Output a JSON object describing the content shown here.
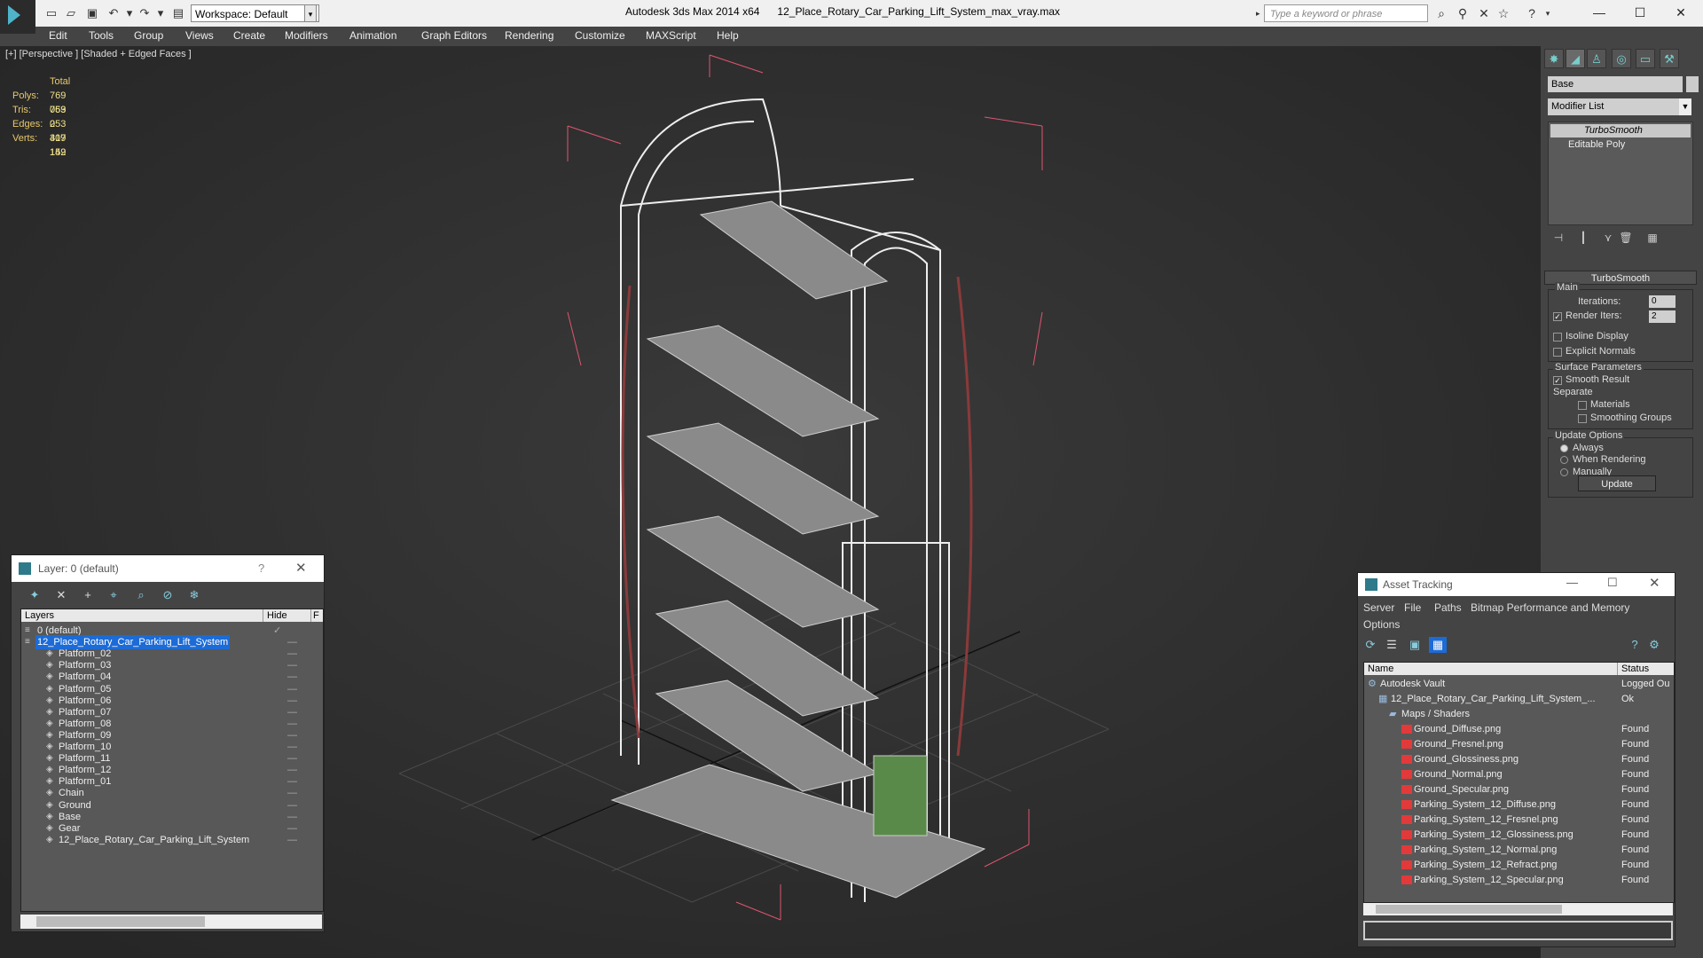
{
  "titlebar": {
    "app_name": "Autodesk 3ds Max  2014 x64",
    "file_name": "12_Place_Rotary_Car_Parking_Lift_System_max_vray.max",
    "workspace": "Workspace: Default",
    "search_placeholder": "Type a keyword or phrase"
  },
  "menubar": {
    "items": [
      "Edit",
      "Tools",
      "Group",
      "Views",
      "Create",
      "Modifiers",
      "Animation",
      "Graph Editors",
      "Rendering",
      "Customize",
      "MAXScript",
      "Help"
    ]
  },
  "viewport": {
    "label": "[+] [Perspective ] [Shaded + Edged Faces ]",
    "stats": {
      "header": "Total",
      "polys_label": "Polys:",
      "polys": "769 053",
      "tris_label": "Tris:",
      "tris": "769 053",
      "edges_label": "Edges:",
      "edges": "2 307 159",
      "verts_label": "Verts:",
      "verts": "419 142"
    }
  },
  "command_panel": {
    "object_name": "Base",
    "modifier_list": "Modifier List",
    "stack": [
      "TurboSmooth",
      "Editable Poly"
    ],
    "rollout_title": "TurboSmooth",
    "main_group": "Main",
    "iterations_label": "Iterations:",
    "iterations": "0",
    "render_iters_label": "Render Iters:",
    "render_iters": "2",
    "isoline_label": "Isoline Display",
    "explicit_normals_label": "Explicit Normals",
    "surface_group": "Surface Parameters",
    "smooth_result_label": "Smooth Result",
    "separate_label": "Separate",
    "materials_label": "Materials",
    "smoothing_groups_label": "Smoothing Groups",
    "update_group": "Update Options",
    "always_label": "Always",
    "when_rendering_label": "When Rendering",
    "manually_label": "Manually",
    "update_button": "Update"
  },
  "layer_window": {
    "title": "Layer: 0 (default)",
    "help": "?",
    "col_layers": "Layers",
    "col_hide": "Hide",
    "col_f": "F",
    "rows": [
      {
        "name": "0 (default)"
      },
      {
        "name": "12_Place_Rotary_Car_Parking_Lift_System"
      },
      {
        "name": "Platform_02"
      },
      {
        "name": "Platform_03"
      },
      {
        "name": "Platform_04"
      },
      {
        "name": "Platform_05"
      },
      {
        "name": "Platform_06"
      },
      {
        "name": "Platform_07"
      },
      {
        "name": "Platform_08"
      },
      {
        "name": "Platform_09"
      },
      {
        "name": "Platform_10"
      },
      {
        "name": "Platform_11"
      },
      {
        "name": "Platform_12"
      },
      {
        "name": "Platform_01"
      },
      {
        "name": "Chain"
      },
      {
        "name": "Ground"
      },
      {
        "name": "Base"
      },
      {
        "name": "Gear"
      },
      {
        "name": "12_Place_Rotary_Car_Parking_Lift_System"
      }
    ]
  },
  "asset_window": {
    "title": "Asset Tracking",
    "menu": [
      "Server",
      "File",
      "Paths",
      "Bitmap Performance and Memory",
      "Options"
    ],
    "col_name": "Name",
    "col_status": "Status",
    "rows": [
      {
        "name": "Autodesk Vault",
        "status": "Logged Ou"
      },
      {
        "name": "12_Place_Rotary_Car_Parking_Lift_System_...",
        "status": "Ok"
      },
      {
        "name": "Maps / Shaders",
        "status": ""
      },
      {
        "name": "Ground_Diffuse.png",
        "status": "Found"
      },
      {
        "name": "Ground_Fresnel.png",
        "status": "Found"
      },
      {
        "name": "Ground_Glossiness.png",
        "status": "Found"
      },
      {
        "name": "Ground_Normal.png",
        "status": "Found"
      },
      {
        "name": "Ground_Specular.png",
        "status": "Found"
      },
      {
        "name": "Parking_System_12_Diffuse.png",
        "status": "Found"
      },
      {
        "name": "Parking_System_12_Fresnel.png",
        "status": "Found"
      },
      {
        "name": "Parking_System_12_Glossiness.png",
        "status": "Found"
      },
      {
        "name": "Parking_System_12_Normal.png",
        "status": "Found"
      },
      {
        "name": "Parking_System_12_Refract.png",
        "status": "Found"
      },
      {
        "name": "Parking_System_12_Specular.png",
        "status": "Found"
      }
    ]
  },
  "colors": {
    "selection": "#1c6bd6",
    "bbox": "#e05570",
    "stats": "#f0e28a"
  }
}
